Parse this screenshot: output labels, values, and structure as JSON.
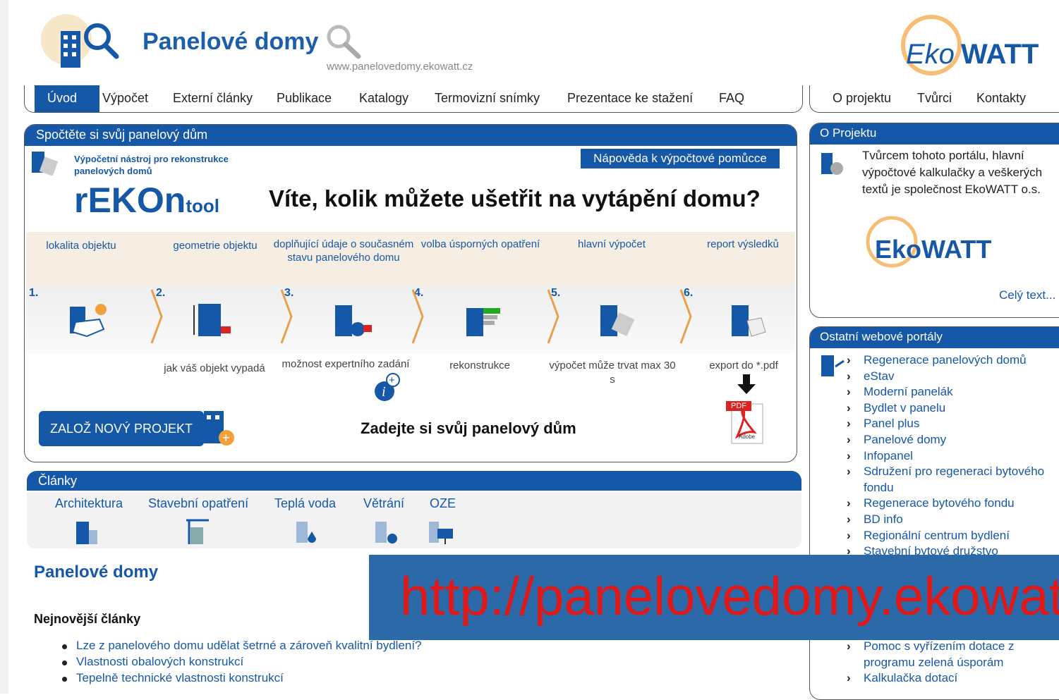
{
  "header": {
    "title": "Panelové domy",
    "url": "www.panelovedomy.ekowatt.cz",
    "brand": "EkoWATT"
  },
  "main_nav": [
    "Úvod",
    "Výpočet",
    "Externí články",
    "Publikace",
    "Katalogy",
    "Termovizní snímky",
    "Prezentace ke stažení",
    "FAQ"
  ],
  "side_nav": [
    "O projektu",
    "Tvůrci",
    "Kontakty"
  ],
  "calculator": {
    "heading": "Spočtěte si svůj panelový dům",
    "tool_description": "Výpočetní nástroj pro rekonstrukce panelových domů",
    "help_button": "Nápověda k výpočtové pomůcce",
    "tool_name": "rEKOn",
    "tool_suffix": "tool",
    "headline": "Víte, kolik můžete ušetřit na vytápění domu?",
    "steps": [
      {
        "num": "1.",
        "label": "lokalita objektu",
        "note": ""
      },
      {
        "num": "2.",
        "label": "geometrie objektu",
        "note": "jak váš objekt vypadá"
      },
      {
        "num": "3.",
        "label": "doplňující údaje o současném stavu panelového domu",
        "note": "možnost expertního zadání"
      },
      {
        "num": "4.",
        "label": "volba úsporných opatření",
        "note": "rekonstrukce"
      },
      {
        "num": "5.",
        "label": "hlavní výpočet",
        "note": "výpočet může trvat max 30 s"
      },
      {
        "num": "6.",
        "label": "report výsledků",
        "note": "export do *.pdf"
      }
    ],
    "new_project_button": "ZALOŽ NOVÝ PROJEKT",
    "prompt": "Zadejte si svůj panelový dům",
    "pdf_label": "PDF",
    "adobe_label": "Adobe"
  },
  "articles_section": {
    "heading": "Články",
    "categories": [
      "Architektura",
      "Stavební opatření",
      "Teplá voda",
      "Větrání",
      "OZE"
    ]
  },
  "page_title": "Panelové domy",
  "newest_heading": "Nejnovější články",
  "newest_articles": [
    "Lze z panelového domu udělat šetrné a zároveň kvalitní bydlení?",
    "Vlastnosti obalových konstrukcí",
    "Tepelně technické vlastnosti konstrukcí"
  ],
  "about": {
    "heading": "O Projektu",
    "text": "Tvůrcem tohoto portálu, hlavní výpočtové kalkulačky a veškerých textů je společnost EkoWATT o.s.",
    "logo": "EkoWATT",
    "more_link": "Celý text..."
  },
  "portals": {
    "heading": "Ostatní webové portály",
    "items": [
      "Regenerace panelových domů",
      "eStav",
      "Moderní panelák",
      "Bydlet v panelu",
      "Panel plus",
      "Panelové domy",
      "Infopanel",
      "Sdružení pro regeneraci bytového fondu",
      "Regenerace bytového fondu",
      "BD info",
      "Regionální centrum bydlení",
      "Stavební bytové družstvo"
    ],
    "items_bottom": [
      "Pomoc s vyřízením dotace z programu zelená úsporám",
      "Kalkulačka dotací"
    ]
  },
  "banner": {
    "text": "http://panelovedomy.ekowatt.cz",
    "color": "#e01818",
    "background": "#2b69a8"
  },
  "colors": {
    "accent": "#1658a8",
    "brand_orange": "#f2a13a"
  }
}
